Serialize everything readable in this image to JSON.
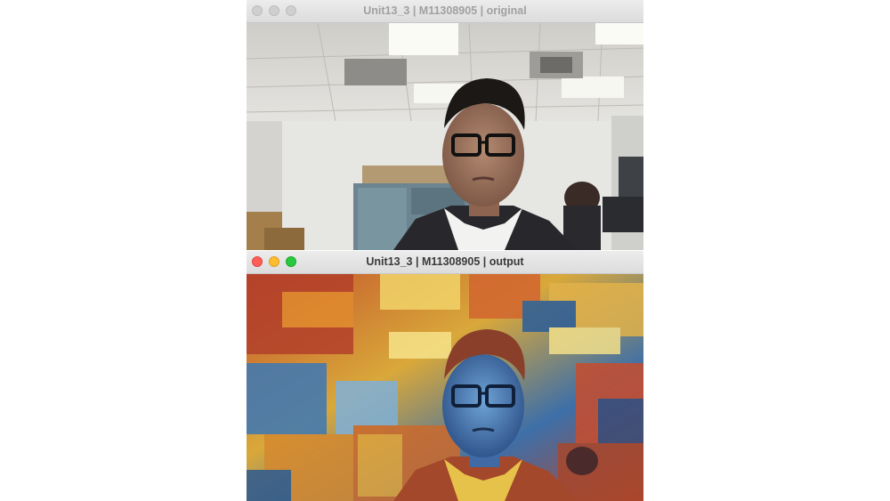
{
  "windows": {
    "original": {
      "title": "Unit13_3 | M11308905 | original",
      "focused": false
    },
    "output": {
      "title": "Unit13_3 | M11308905 | output",
      "focused": true
    }
  },
  "icons": [
    "close-button",
    "minimize-button",
    "zoom-button"
  ],
  "colors": {
    "close": "#ff5f57",
    "minimize": "#febc2e",
    "zoom": "#28c840",
    "inactive": "#cfcfcf"
  }
}
